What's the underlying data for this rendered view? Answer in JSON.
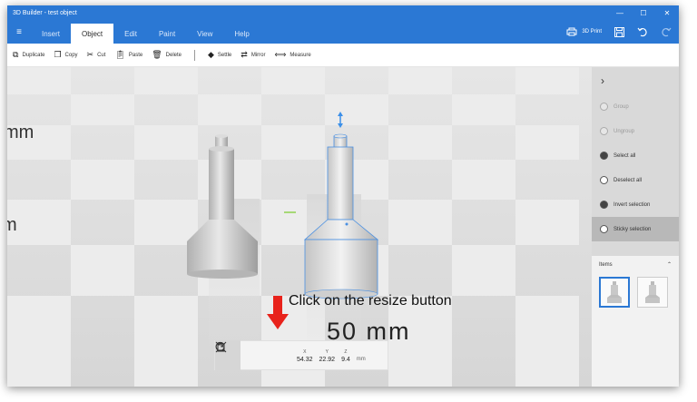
{
  "window": {
    "title": "3D Builder - test object",
    "minimize_glyph": "—",
    "maximize_glyph": "☐",
    "close_glyph": "✕"
  },
  "menubar": {
    "hamburger_glyph": "≡",
    "tabs": [
      {
        "label": "Insert"
      },
      {
        "label": "Object"
      },
      {
        "label": "Edit"
      },
      {
        "label": "Paint"
      },
      {
        "label": "View"
      },
      {
        "label": "Help"
      }
    ],
    "print_label": "3D Print"
  },
  "toolbar": {
    "duplicate": "Duplicate",
    "copy": "Copy",
    "cut": "Cut",
    "paste": "Paste",
    "delete": "Delete",
    "settle": "Settle",
    "mirror": "Mirror",
    "measure": "Measure"
  },
  "right_panel": {
    "chevron": "›",
    "actions": [
      {
        "label": "Group",
        "enabled": false
      },
      {
        "label": "Ungroup",
        "enabled": false
      },
      {
        "label": "Select all",
        "enabled": true
      },
      {
        "label": "Deselect all",
        "enabled": true
      },
      {
        "label": "Invert selection",
        "enabled": true
      },
      {
        "label": "Sticky selection",
        "enabled": true,
        "selected": true
      }
    ],
    "items_title": "Items",
    "items_chevron": "⌃"
  },
  "viewport": {
    "ruler_label_left_top": "mm",
    "ruler_label_left_mid": "m",
    "floor_label": "50 mm",
    "callout_text": "Click on the resize button",
    "arrow_color": "#e8221b"
  },
  "transform_bar": {
    "x_label": "X",
    "y_label": "Y",
    "z_label": "Z",
    "x": "54.32",
    "y": "22.92",
    "z": "9.4",
    "unit": "mm"
  },
  "colors": {
    "accent": "#2b78d4",
    "selection_outline": "#4a90e2"
  }
}
